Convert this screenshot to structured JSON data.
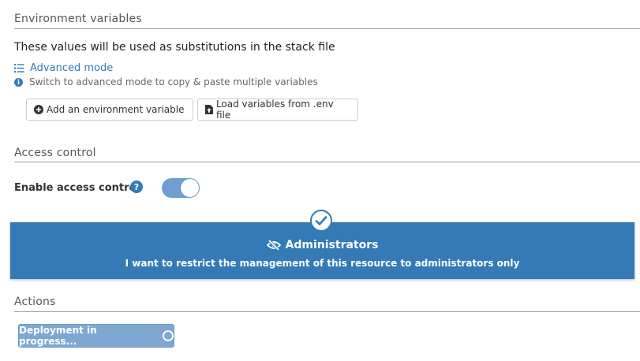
{
  "env": {
    "title": "Environment variables",
    "description": "These values will be used as substitutions in the stack file",
    "advanced_mode_link": "Advanced mode",
    "advanced_hint": "Switch to advanced mode to copy & paste multiple variables",
    "add_button": "Add an environment variable",
    "load_button": "Load variables from .env file"
  },
  "access": {
    "title": "Access control",
    "enable_label": "Enable access control",
    "help_glyph": "?",
    "toggle_on": true,
    "admin_title": "Administrators",
    "admin_description": "I want to restrict the management of this resource to administrators only"
  },
  "actions": {
    "title": "Actions",
    "deploy_button": "Deployment in progress..."
  },
  "colors": {
    "primary": "#337ab7",
    "toggle_on": "#6f9ed0",
    "deploy_disabled": "#7ea8d2"
  },
  "icons": {
    "advanced_mode": "list-icon",
    "hint": "info-circle-icon",
    "add": "plus-circle-icon",
    "load": "file-upload-icon",
    "help": "question-circle-icon",
    "admin_check": "check-circle-icon",
    "admin": "eye-slash-icon",
    "deploy": "spinner-icon"
  }
}
